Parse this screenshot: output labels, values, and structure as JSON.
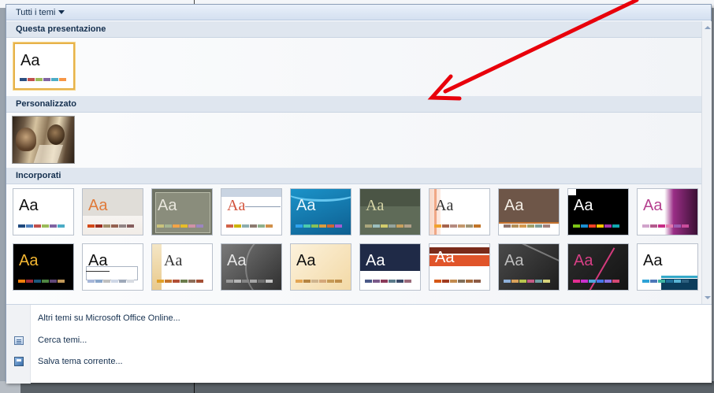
{
  "dropdown": {
    "header_title": "Tutti i temi",
    "sections": {
      "this_presentation": "Questa presentazione",
      "custom": "Personalizzato",
      "builtin": "Incorporati"
    },
    "thumb_label": "Aa",
    "menu": {
      "more_themes_online": "Altri temi su Microsoft Office Online...",
      "browse_themes": "Cerca temi...",
      "save_current_theme": "Salva tema corrente..."
    }
  },
  "colors": {
    "selected_border": "#e6b24a",
    "arrow": "#e8000b"
  },
  "icons": {
    "header_caret": "caret-down-icon",
    "browse": "folder-icon",
    "save": "save-icon"
  }
}
